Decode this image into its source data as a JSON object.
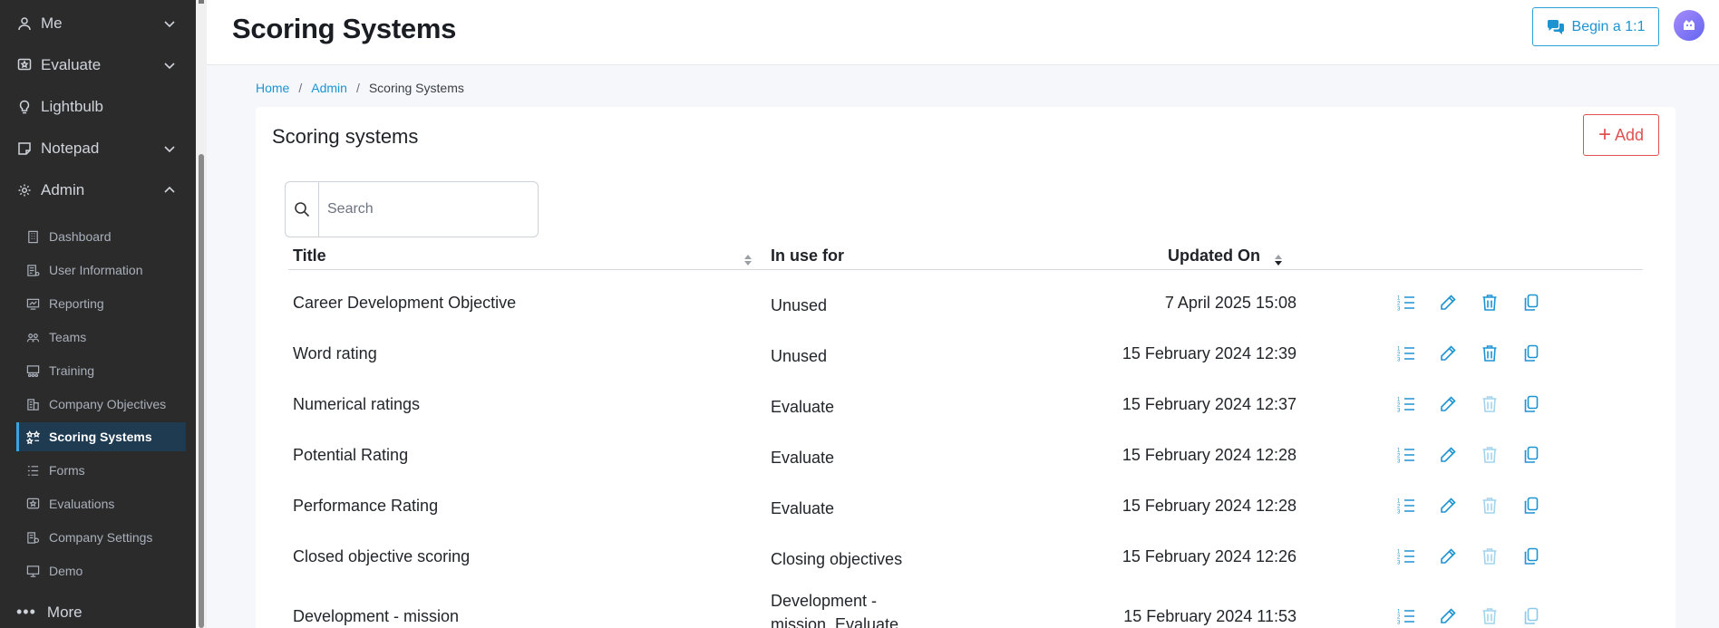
{
  "sidebar": {
    "top_items": [
      {
        "label": "Me",
        "icon": "user-icon",
        "expanded": false
      },
      {
        "label": "Evaluate",
        "icon": "star-badge-icon",
        "expanded": false
      },
      {
        "label": "Lightbulb",
        "icon": "lightbulb-icon"
      },
      {
        "label": "Notepad",
        "icon": "note-icon",
        "expanded": false
      },
      {
        "label": "Admin",
        "icon": "gear-icon",
        "expanded": true
      }
    ],
    "admin_items": [
      {
        "label": "Dashboard",
        "icon": "building-icon"
      },
      {
        "label": "User Information",
        "icon": "user-list-icon"
      },
      {
        "label": "Reporting",
        "icon": "report-icon"
      },
      {
        "label": "Teams",
        "icon": "team-icon"
      },
      {
        "label": "Training",
        "icon": "training-icon"
      },
      {
        "label": "Company Objectives",
        "icon": "company-objectives-icon"
      },
      {
        "label": "Scoring Systems",
        "icon": "scoring-icon",
        "active": true
      },
      {
        "label": "Forms",
        "icon": "form-list-icon"
      },
      {
        "label": "Evaluations",
        "icon": "evaluation-icon"
      },
      {
        "label": "Company Settings",
        "icon": "company-settings-icon"
      },
      {
        "label": "Demo",
        "icon": "monitor-icon"
      }
    ],
    "more_label": "More"
  },
  "header": {
    "title": "Scoring Systems",
    "begin_button": "Begin a 1:1",
    "accent_color": "#1d94d2"
  },
  "breadcrumb": {
    "home": "Home",
    "admin": "Admin",
    "current": "Scoring Systems"
  },
  "card": {
    "title": "Scoring systems",
    "add_label": "Add",
    "add_color": "#e05252",
    "search": {
      "placeholder": "Search",
      "value": ""
    }
  },
  "table": {
    "columns": {
      "title": "Title",
      "in_use": "In use for",
      "updated": "Updated On"
    },
    "rows": [
      {
        "title": "Career Development Objective",
        "in_use": [
          "Unused"
        ],
        "updated": "7 April 2025 15:08",
        "delete_enabled": true
      },
      {
        "title": "Word rating",
        "in_use": [
          "Unused"
        ],
        "updated": "15 February 2024 12:39",
        "delete_enabled": true
      },
      {
        "title": "Numerical ratings",
        "in_use": [
          "Evaluate"
        ],
        "updated": "15 February 2024 12:37",
        "delete_enabled": false
      },
      {
        "title": "Potential Rating",
        "in_use": [
          "Evaluate"
        ],
        "updated": "15 February 2024 12:28",
        "delete_enabled": false
      },
      {
        "title": "Performance Rating",
        "in_use": [
          "Evaluate"
        ],
        "updated": "15 February 2024 12:28",
        "delete_enabled": false
      },
      {
        "title": "Closed objective scoring",
        "in_use": [
          "Closing objectives"
        ],
        "updated": "15 February 2024 12:26",
        "delete_enabled": false
      },
      {
        "title": "Development - mission",
        "in_use": [
          "Development -",
          "mission, Evaluate"
        ],
        "updated": "15 February 2024 11:53",
        "delete_enabled": false
      }
    ],
    "action_icons": [
      "numbered-list-icon",
      "pencil-icon",
      "trash-icon",
      "copy-icon"
    ]
  }
}
